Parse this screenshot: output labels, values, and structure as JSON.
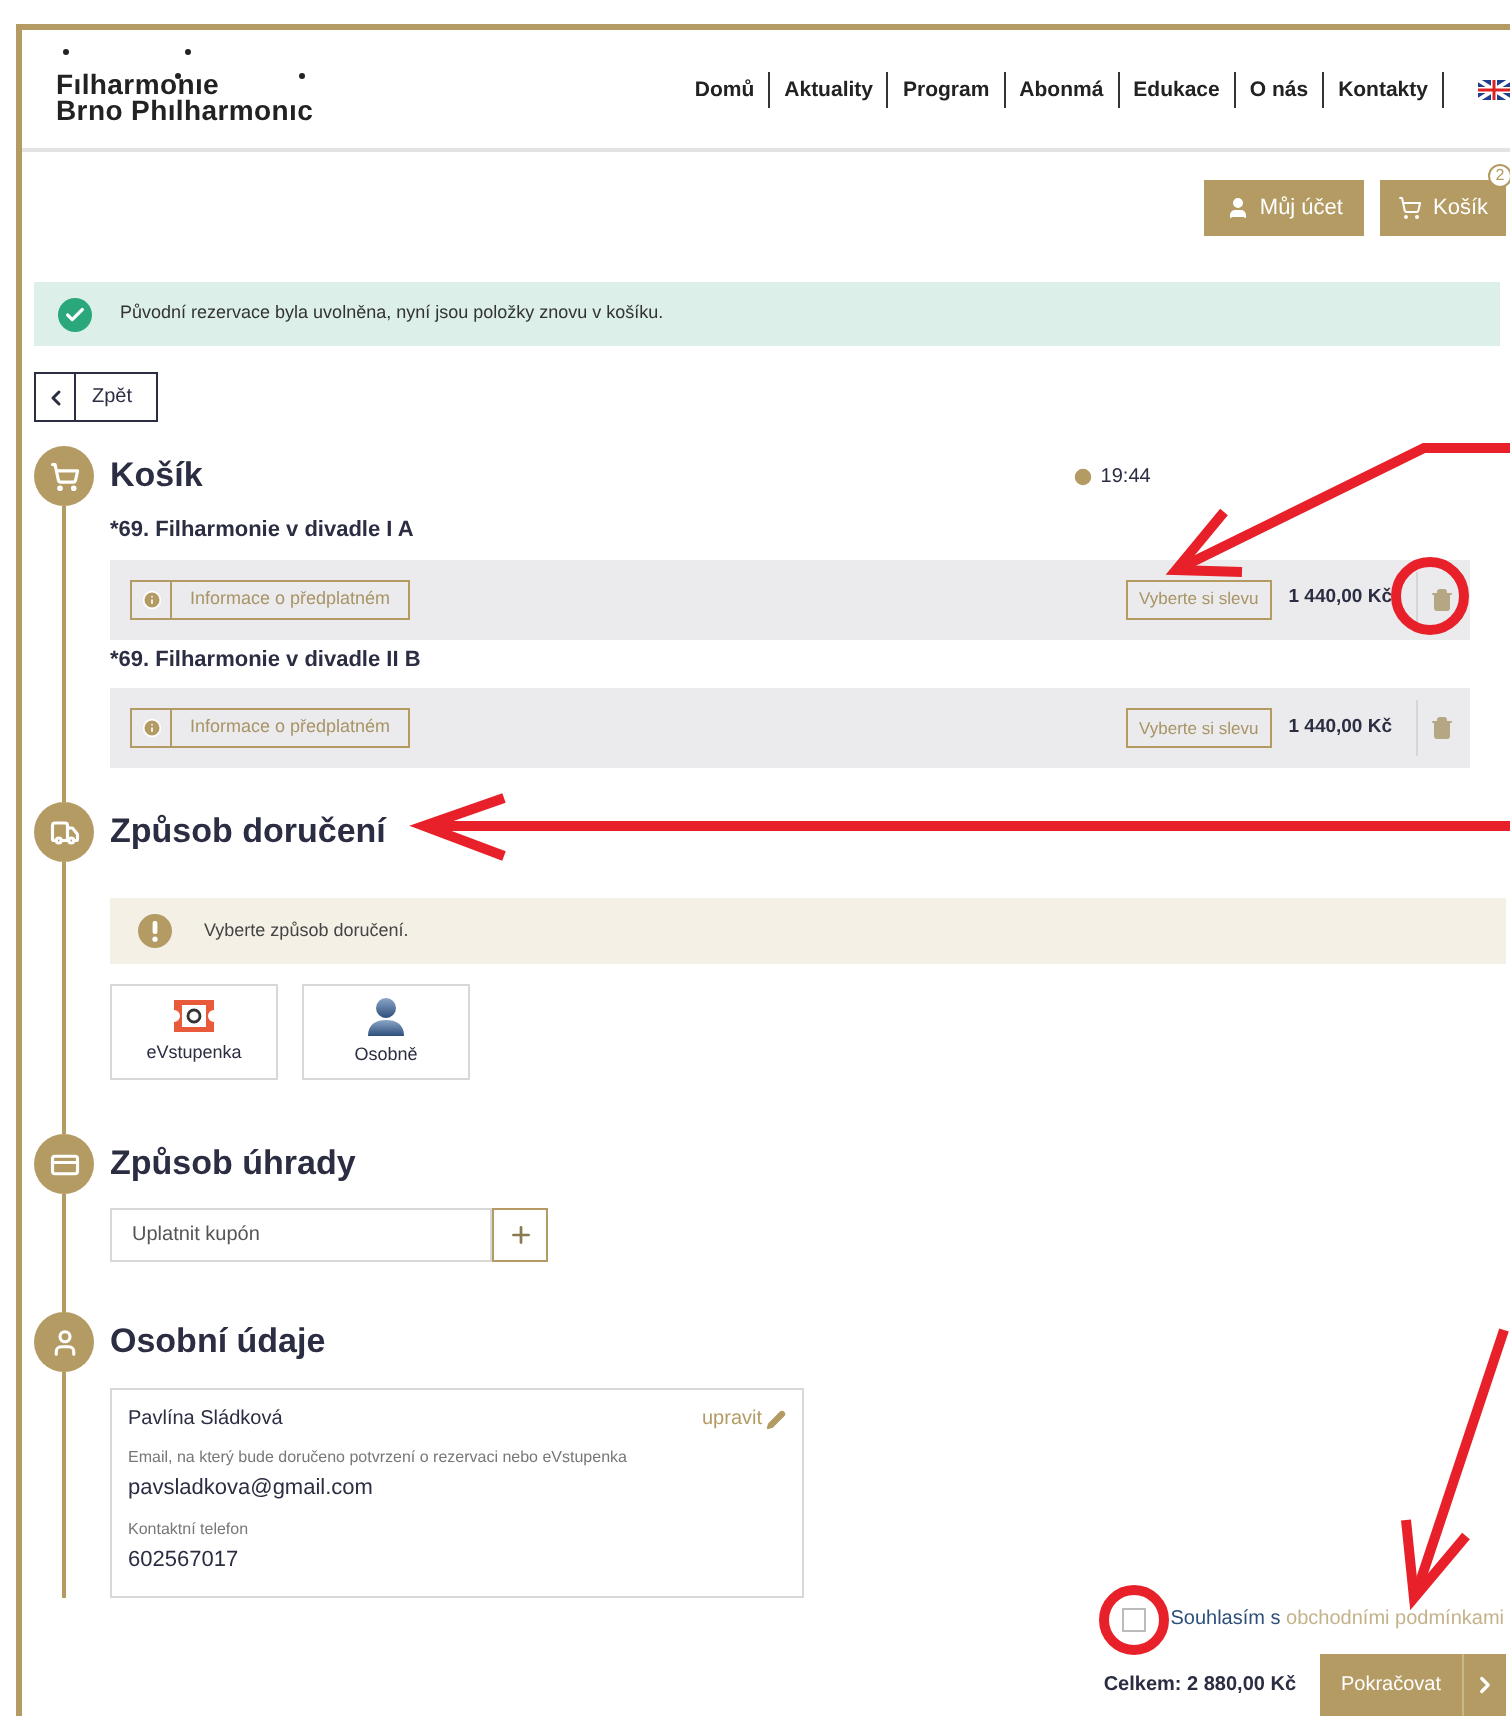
{
  "logo": {
    "line1": "Fılharmonıe",
    "line2": "Brno Phılharmonıc"
  },
  "nav": [
    {
      "label": "Domů"
    },
    {
      "label": "Aktuality"
    },
    {
      "label": "Program"
    },
    {
      "label": "Abonmá"
    },
    {
      "label": "Edukace"
    },
    {
      "label": "O nás"
    },
    {
      "label": "Kontakty"
    }
  ],
  "account_button": "Můj účet",
  "cart_button": {
    "label": "Košík",
    "count": "2"
  },
  "alert": "Původní rezervace byla uvolněna, nyní jsou položky znovu v košíku.",
  "back_button": "Zpět",
  "cart": {
    "title": "Košík",
    "timer": "19:44",
    "items": [
      {
        "title": "*69. Filharmonie v divadle I A",
        "info": "Informace o předplatném",
        "discount": "Vyberte si slevu",
        "price": "1 440,00 Kč"
      },
      {
        "title": "*69. Filharmonie v divadle II B",
        "info": "Informace o předplatném",
        "discount": "Vyberte si slevu",
        "price": "1 440,00 Kč"
      }
    ]
  },
  "delivery": {
    "title": "Způsob doručení",
    "warning": "Vyberte způsob doručení.",
    "options": [
      {
        "kind": "eticket",
        "label": "eVstupenka",
        "selected": false
      },
      {
        "kind": "person",
        "label": "Osobně",
        "selected": false
      }
    ]
  },
  "payment": {
    "title": "Způsob úhrady",
    "coupon_placeholder": "Uplatnit kupón"
  },
  "personal": {
    "title": "Osobní údaje",
    "name": "Pavlína Sládková",
    "edit": "upravit",
    "fields": [
      {
        "label": "Email, na který bude doručeno potvrzení o rezervaci nebo eVstupenka",
        "value": "pavsladkova@gmail.com"
      },
      {
        "label": "Kontaktní telefon",
        "value": "602567017"
      }
    ]
  },
  "terms": {
    "checked": false,
    "text": "Souhlasím s",
    "link": "obchodními podmínkami"
  },
  "total": "Celkem: 2 880,00 Kč",
  "continue_button": "Pokračovat"
}
